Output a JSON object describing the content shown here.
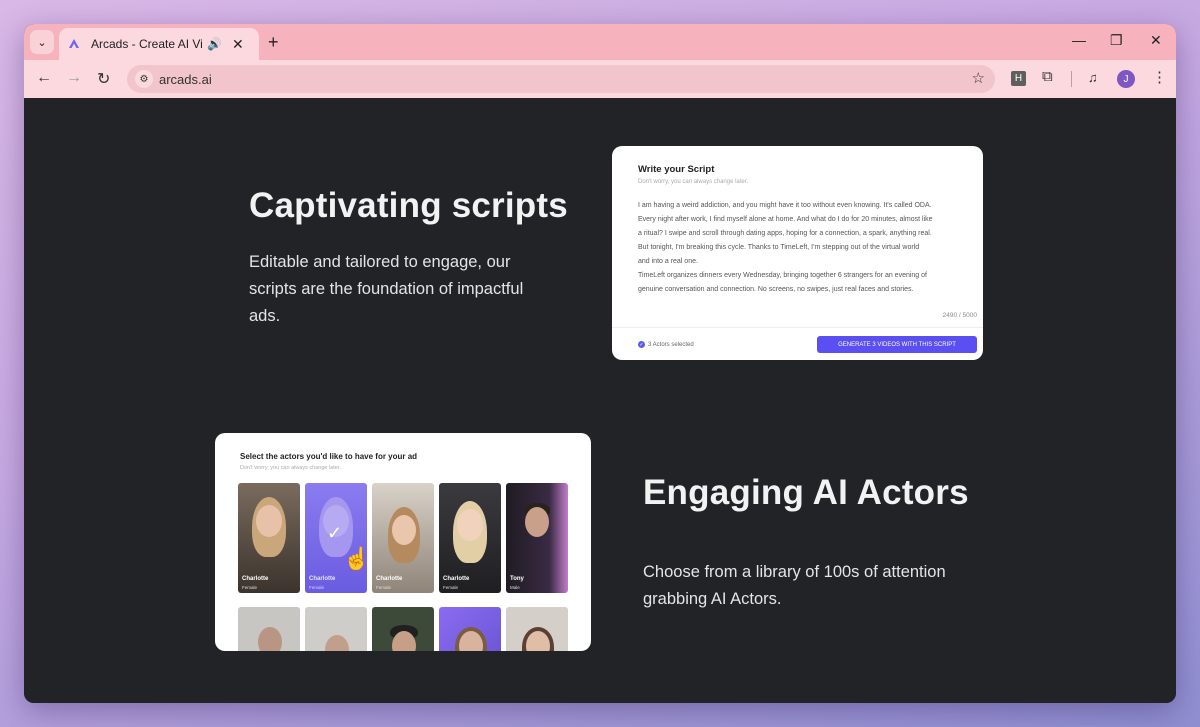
{
  "browser": {
    "tab_title": "Arcads - Create AI Video Ads",
    "url": "arcads.ai",
    "profile_initial": "J",
    "extension_letter": "H"
  },
  "section_scripts": {
    "heading": "Captivating scripts",
    "description_lines": [
      "Editable and tailored to engage, our",
      "scripts are the foundation of impactful",
      "ads."
    ]
  },
  "script_card": {
    "title": "Write your Script",
    "subtitle": "Don't worry, you can always change later.",
    "body_lines": [
      "I am having a weird addiction, and you might have it too without even knowing. It's called ODA.",
      "Every night after work, I find myself alone at home. And what do I do for 20 minutes, almost like",
      "a ritual? I swipe and scroll through dating apps, hoping for a connection, a spark, anything real.",
      "But tonight, I'm breaking this cycle. Thanks to TimeLeft, I'm stepping out of the virtual world",
      "and into a real one.",
      "TimeLeft organizes dinners every Wednesday, bringing together 6 strangers for an evening of",
      "genuine conversation and connection. No screens, no swipes, just real faces and stories."
    ],
    "char_count": "2490 / 5000",
    "actors_selected": "3 Actors selected",
    "generate_button": "GENERATE 3 VIDEOS WITH THIS SCRIPT"
  },
  "actors_card": {
    "title": "Select the actors you'd like to have for your ad",
    "subtitle": "Don't worry, you can always change later.",
    "actors": [
      {
        "name": "Charlotte",
        "gender": "Female"
      },
      {
        "name": "Charlotte",
        "gender": "Female"
      },
      {
        "name": "Charlotte",
        "gender": "Female"
      },
      {
        "name": "Charlotte",
        "gender": "Female"
      },
      {
        "name": "Tony",
        "gender": "Male"
      }
    ]
  },
  "section_actors": {
    "heading": "Engaging AI Actors",
    "description_lines": [
      "Choose from a library of 100s of attention",
      "grabbing AI Actors."
    ]
  },
  "colors": {
    "accent": "#5b4ff2",
    "page_bg": "#222327",
    "tab_strip": "#f6b3bd"
  }
}
